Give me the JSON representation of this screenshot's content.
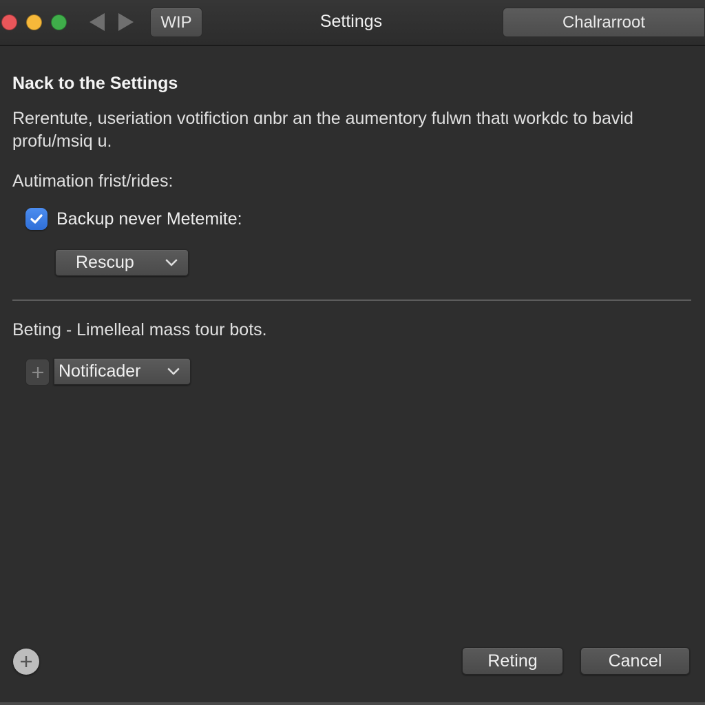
{
  "titlebar": {
    "title": "Settings",
    "wip_button_label": "WIP",
    "right_field_text": "Chalrarroot",
    "traffic_lights": {
      "close_color": "#e9565a",
      "minimize_color": "#f6b83a",
      "maximize_color": "#3fae4a"
    },
    "nav": {
      "back_icon": "triangle-left",
      "forward_icon": "triangle-right"
    }
  },
  "main": {
    "heading": "Nack to the Settings",
    "description": "Rerentute, useriation votifiction ɑnbr an the aumentory fulwn thatι workdc to bavid profu/msiq u.",
    "section1": {
      "label": "Autimation frist/rides:",
      "checkbox": {
        "label": "Backup never Metemite:",
        "checked": true,
        "accent_color": "#3a7ee6"
      },
      "popup": {
        "selected": "Rescup",
        "icon": "chevron-down"
      }
    },
    "section2": {
      "label": "Beting - Limelleal mass tour bots.",
      "add_icon": "plus",
      "popup": {
        "selected": "Notificader",
        "icon": "chevron-down"
      }
    }
  },
  "footer": {
    "add_icon": "plus-circle",
    "buttons": [
      {
        "label": "Reting"
      },
      {
        "label": "Cancel"
      }
    ]
  }
}
